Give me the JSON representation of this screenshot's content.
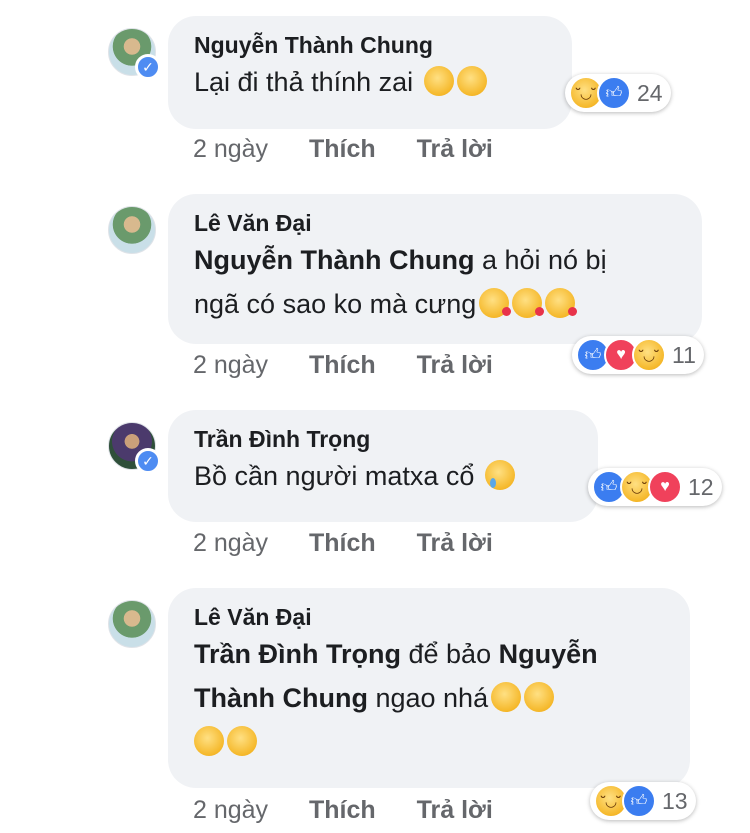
{
  "comments": [
    {
      "author": "Nguyễn Thành Chung",
      "verified": true,
      "text": "Lại đi thả thính zai",
      "emojis": [
        "unamused-emoji",
        "unamused-emoji"
      ],
      "time": "2 ngày",
      "like_label": "Thích",
      "reply_label": "Trả lời",
      "reactions": [
        "haha",
        "like"
      ],
      "reaction_count": "24"
    },
    {
      "author": "Lê Văn Đại",
      "verified": false,
      "mention": "Nguyễn Thành Chung",
      "text_line1": " a hỏi nó bị",
      "text_line2": "ngã có sao ko mà cưng",
      "emojis": [
        "kissing-heart-emoji",
        "kissing-heart-emoji",
        "kissing-heart-emoji"
      ],
      "time": "2 ngày",
      "like_label": "Thích",
      "reply_label": "Trả lời",
      "reactions": [
        "like",
        "love",
        "haha"
      ],
      "reaction_count": "11"
    },
    {
      "author": "Trần Đình Trọng",
      "verified": true,
      "text": "Bồ cần người matxa cổ",
      "emojis": [
        "crying-emoji"
      ],
      "time": "2 ngày",
      "like_label": "Thích",
      "reply_label": "Trả lời",
      "reactions": [
        "like",
        "haha",
        "love"
      ],
      "reaction_count": "12"
    },
    {
      "author": "Lê Văn Đại",
      "verified": false,
      "mention1": "Trần Đình Trọng",
      "text_mid": " để bảo ",
      "mention2_line1": "Nguyễn",
      "mention2_line2": "Thành Chung",
      "text_end": " ngao nhá",
      "emojis": [
        "wink-emoji",
        "wink-emoji",
        "wink-emoji",
        "wink-emoji"
      ],
      "time": "2 ngày",
      "like_label": "Thích",
      "reply_label": "Trả lời",
      "reactions": [
        "haha",
        "like"
      ],
      "reaction_count": "13"
    }
  ]
}
